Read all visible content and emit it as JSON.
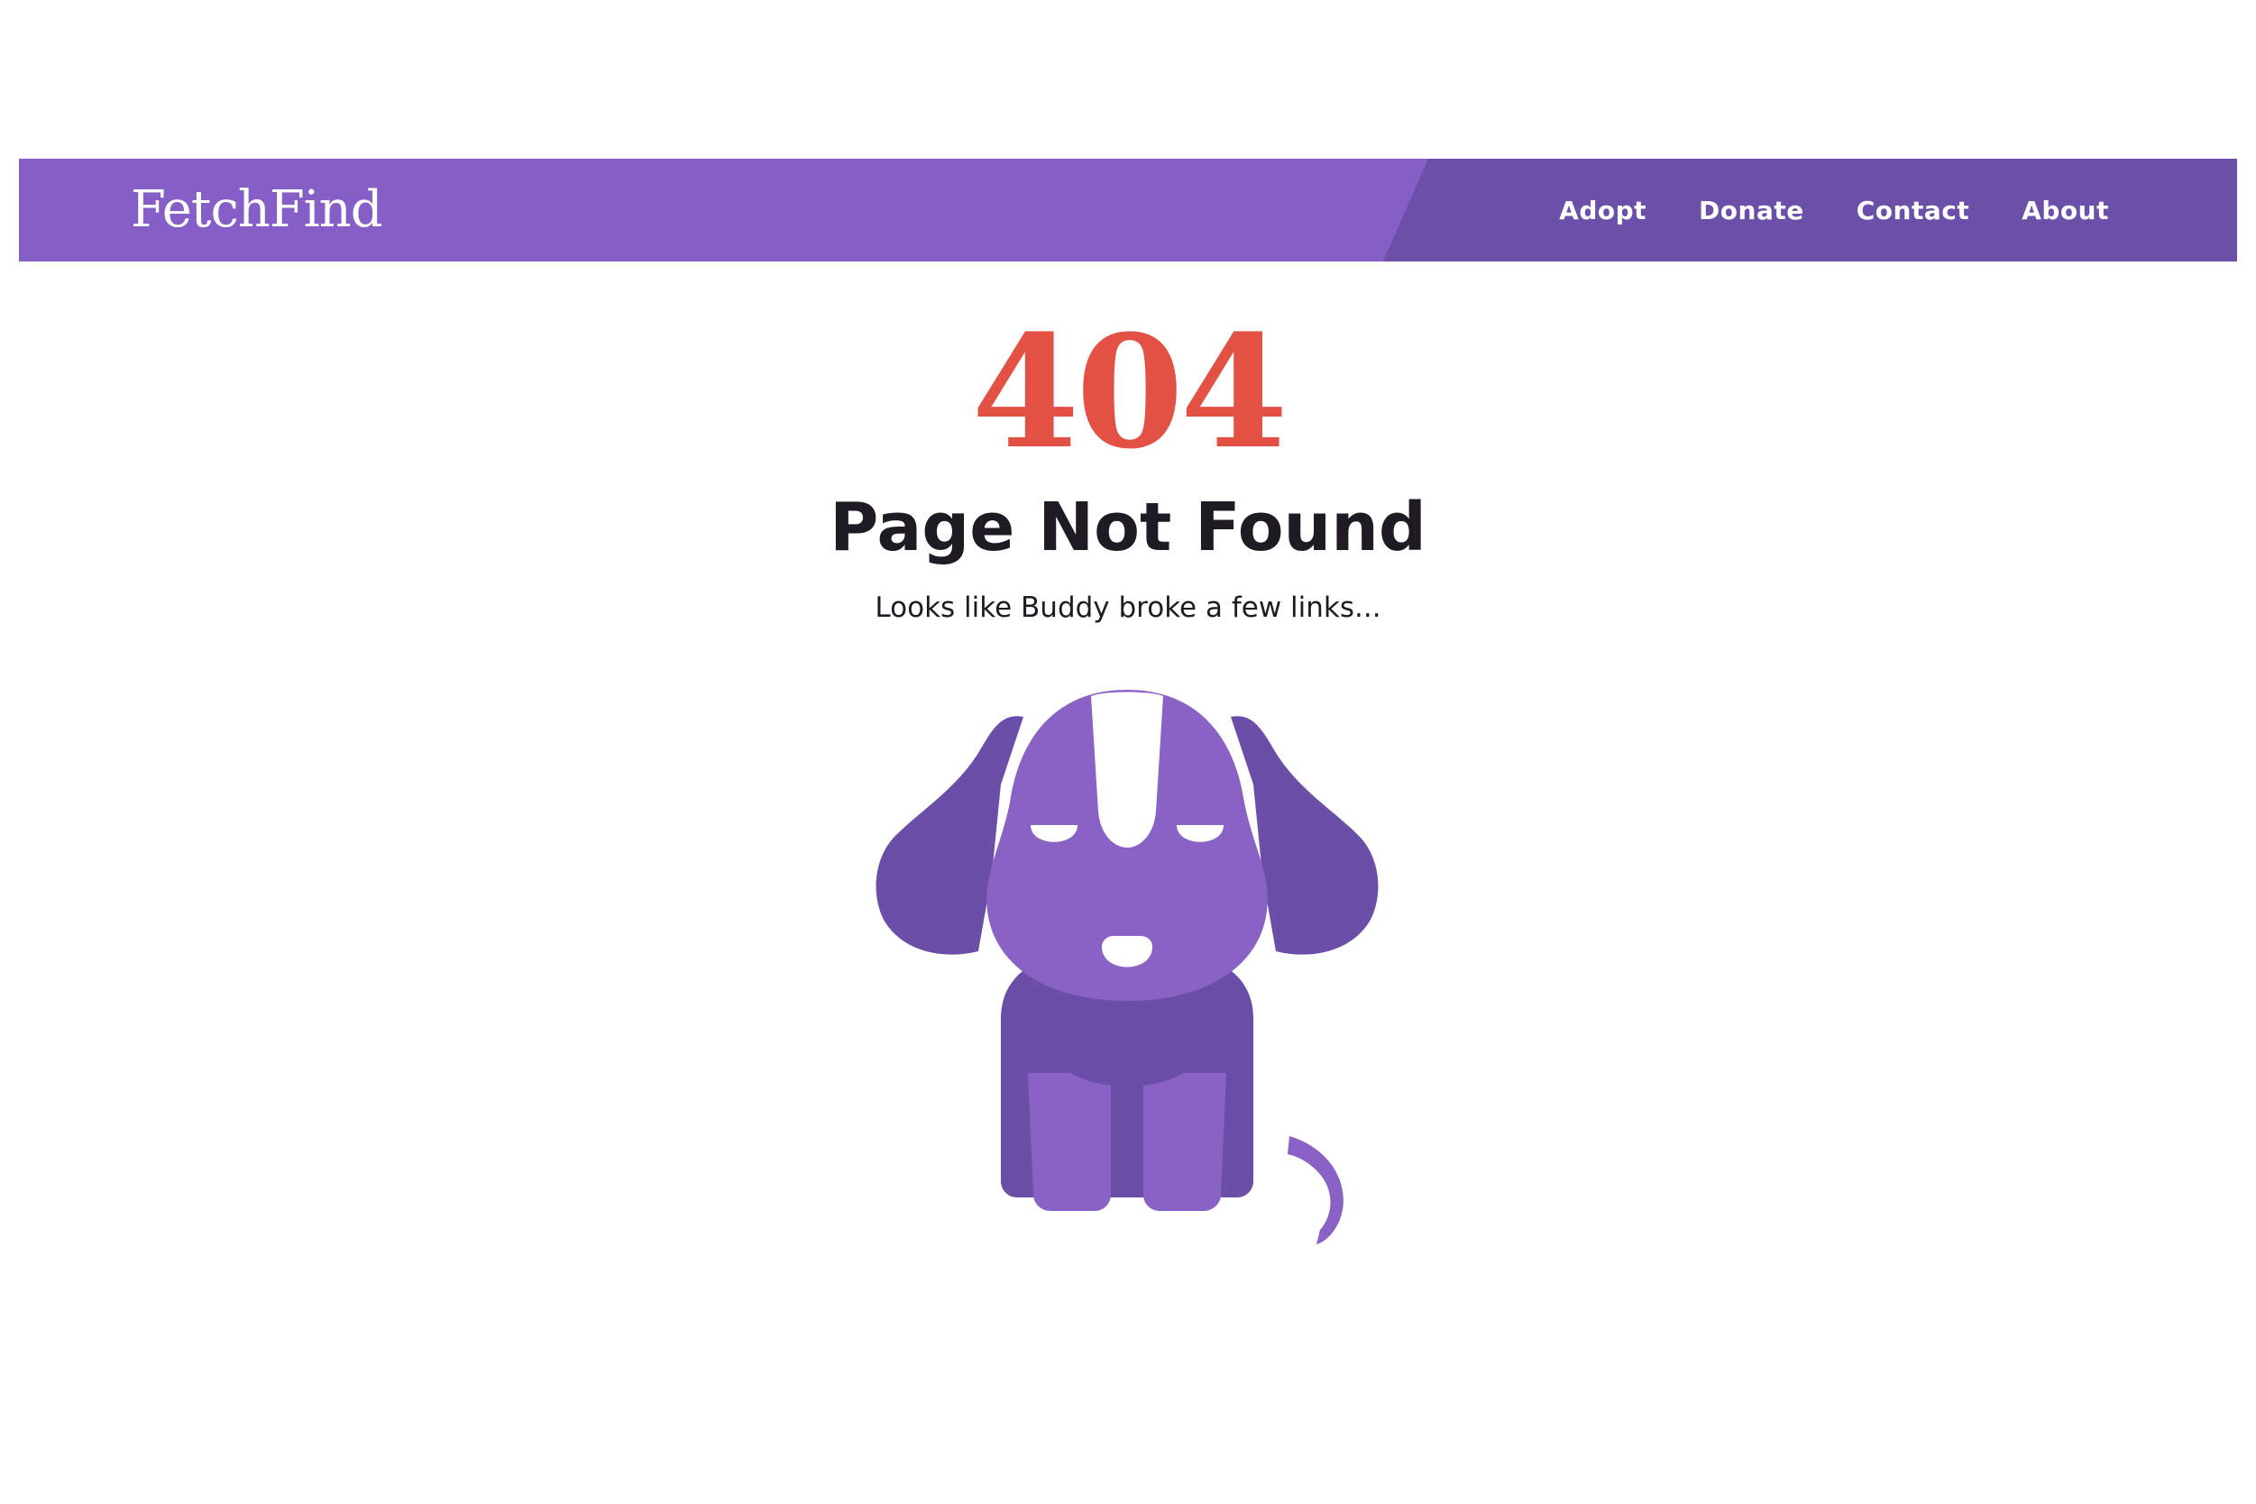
{
  "header": {
    "brand": "FetchFind",
    "nav": [
      {
        "label": "Adopt"
      },
      {
        "label": "Donate"
      },
      {
        "label": "Contact"
      },
      {
        "label": "About"
      }
    ]
  },
  "main": {
    "error_code": "404",
    "title": "Page Not Found",
    "subtitle": "Looks like Buddy broke a few links..."
  },
  "illustration": {
    "icon": "sad-dog-illustration"
  },
  "colors": {
    "nav_primary": "#865ec8",
    "nav_secondary": "#6b4fa8",
    "error_code": "#e35144",
    "text": "#1f1a24",
    "dog_light": "#8a62c6",
    "dog_dark": "#6a4ea8",
    "dog_accent": "#ffffff"
  }
}
